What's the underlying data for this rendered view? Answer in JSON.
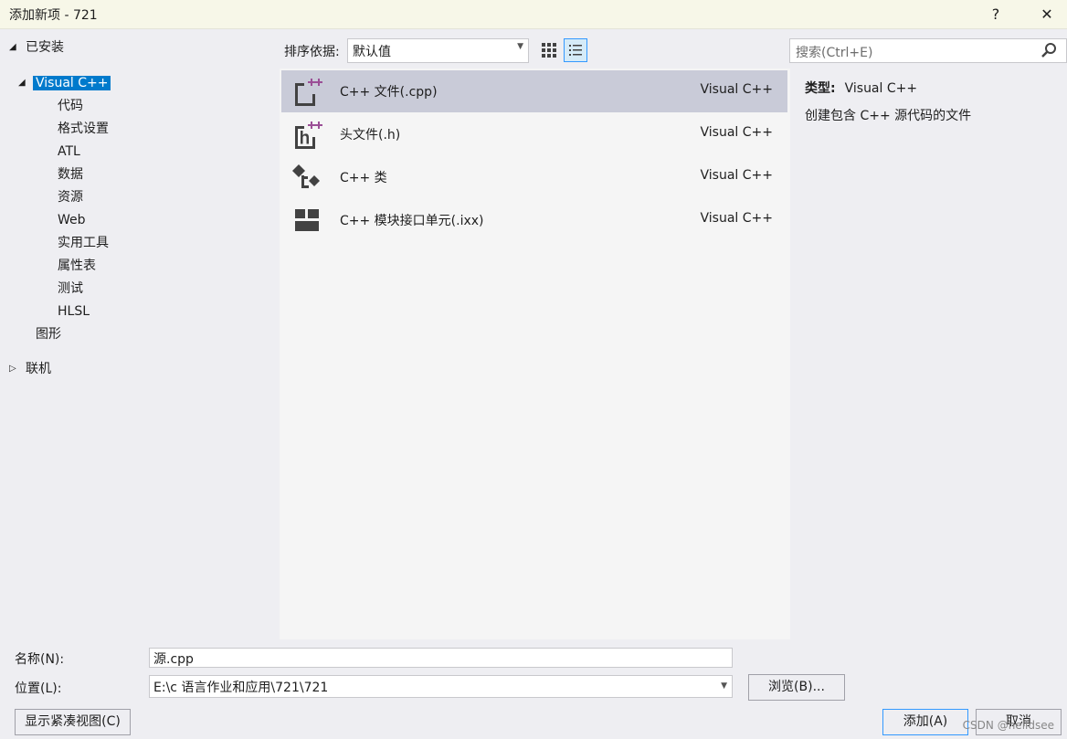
{
  "window": {
    "title": "添加新项 - 721",
    "help_label": "?",
    "close_label": "✕"
  },
  "tree": {
    "installed_label": "已安装",
    "visual_cpp_label": "Visual C++",
    "children": [
      "代码",
      "格式设置",
      "ATL",
      "数据",
      "资源",
      "Web",
      "实用工具",
      "属性表",
      "测试",
      "HLSL"
    ],
    "graphics_label": "图形",
    "online_label": "联机"
  },
  "toolbar": {
    "sort_label": "排序依据:",
    "sort_value": "默认值"
  },
  "search": {
    "placeholder": "搜索(Ctrl+E)"
  },
  "items": [
    {
      "name": "C++ 文件(.cpp)",
      "lang": "Visual C++",
      "icon": "cpp-file-icon"
    },
    {
      "name": "头文件(.h)",
      "lang": "Visual C++",
      "icon": "header-file-icon"
    },
    {
      "name": "C++ 类",
      "lang": "Visual C++",
      "icon": "cpp-class-icon"
    },
    {
      "name": "C++ 模块接口单元(.ixx)",
      "lang": "Visual C++",
      "icon": "module-interface-icon"
    }
  ],
  "details": {
    "type_label": "类型:",
    "type_value": "Visual C++",
    "description": "创建包含 C++ 源代码的文件"
  },
  "form": {
    "name_label": "名称(N):",
    "name_value": "源.cpp",
    "location_label": "位置(L):",
    "location_value": "E:\\c 语言作业和应用\\721\\721",
    "browse_label": "浏览(B)...",
    "compact_label": "显示紧凑视图(C)",
    "add_label": "添加(A)",
    "cancel_label": "取消"
  },
  "watermark": "CSDN @helldsee",
  "colors": {
    "accent": "#007acc",
    "selected_row": "#c9cbd8",
    "icon_purple": "#9b4f96"
  }
}
